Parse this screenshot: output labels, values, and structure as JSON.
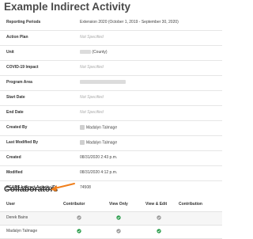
{
  "page": {
    "title": "Example Indirect Activity"
  },
  "details": [
    {
      "label": "Reporting Periods",
      "value": "Extension 2020 (October 1, 2019 - September 30, 2020)"
    },
    {
      "label": "Action Plan",
      "value": "Not Specified"
    },
    {
      "label": "Unit",
      "value": "(County)"
    },
    {
      "label": "COVID-19 Impact",
      "value": "Not Specified"
    },
    {
      "label": "Program Area",
      "value": ""
    },
    {
      "label": "Start Date",
      "value": "Not Specified"
    },
    {
      "label": "End Date",
      "value": "Not Specified"
    },
    {
      "label": "Created By",
      "value": "Madalyn Talmage"
    },
    {
      "label": "Last Modified By",
      "value": "Madalyn Talmage"
    },
    {
      "label": "Created",
      "value": "08/31/2020 2:43 p.m."
    },
    {
      "label": "Modified",
      "value": "08/31/2020 4:12 p.m."
    },
    {
      "label": "PEARS Indirect Activity ID",
      "value": "74508"
    }
  ],
  "collaborators": {
    "title": "Collaborators",
    "columns": [
      "User",
      "Contributor",
      "View Only",
      "View & Edit",
      "Contribution"
    ],
    "rows": [
      {
        "user": "Derek Bains",
        "contributor": "check-gray",
        "view_only": "check-green",
        "view_edit": "check-gray"
      },
      {
        "user": "Madalyn Talmage",
        "contributor": "check-green",
        "view_only": "check-gray",
        "view_edit": "check-green"
      }
    ]
  },
  "colors": {
    "check_green": "#2e9e4f",
    "check_gray": "#9a9a9a",
    "arrow": "#f07f1c"
  }
}
